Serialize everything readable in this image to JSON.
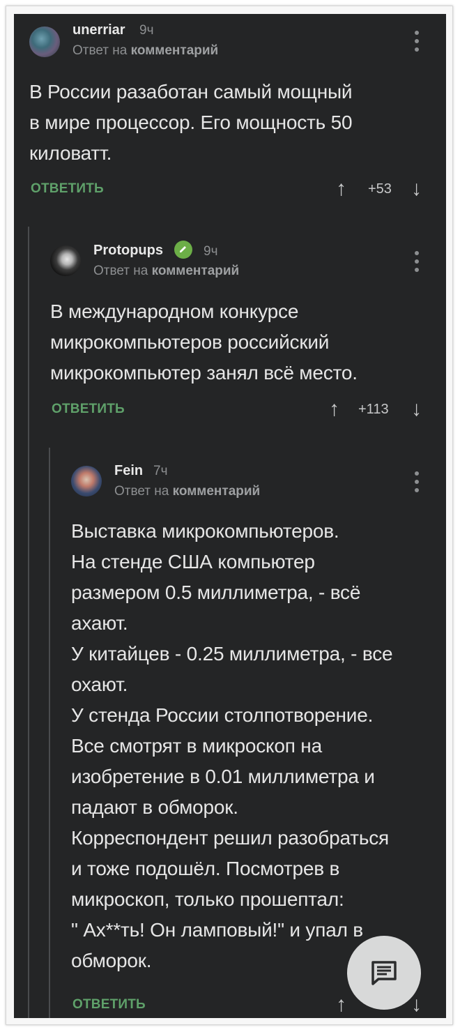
{
  "comments": [
    {
      "author": "unerriar",
      "time": "9ч",
      "reply_prefix": "Ответ на",
      "reply_target": "комментарий",
      "text": "В России разаботан самый мощный\nв мире процессор. Его мощность 50\nкиловатт.",
      "reply_label": "ОТВЕТИТЬ",
      "score": "+53"
    },
    {
      "author": "Protopups",
      "time": "9ч",
      "reply_prefix": "Ответ на",
      "reply_target": "комментарий",
      "text": "В международном конкурсе\nмикрокомпьютеров российский\nмикрокомпьютер занял всё место.",
      "reply_label": "ОТВЕТИТЬ",
      "score": "+113"
    },
    {
      "author": "Fein",
      "time": "7ч",
      "reply_prefix": "Ответ на",
      "reply_target": "комментарий",
      "text": "Выставка микрокомпьютеров.\nНа стенде США компьютер\nразмером 0.5 миллиметра, - всё\nахают.\nУ китайцев - 0.25 миллиметра, - все\nохают.\nУ стенда России столпотворение.\nВсе смотрят в микроскоп на\nизобретение в 0.01 миллиметра и\nпадают в обморок.\nКорреспондент решил разобраться\nи тоже подошёл. Посмотрев в\nмикроскоп, только прошептал:\n\" Ах**ть! Он ламповый!\" и упал в\nобморок.",
      "reply_label": "ОТВЕТИТЬ"
    }
  ],
  "icons": {
    "up": "↑",
    "down": "↓",
    "fab": "comment-icon",
    "verified": "pencil-check-icon"
  },
  "colors": {
    "background": "#242526",
    "accent_green": "#5fa16a",
    "verified_green": "#6cae47"
  }
}
